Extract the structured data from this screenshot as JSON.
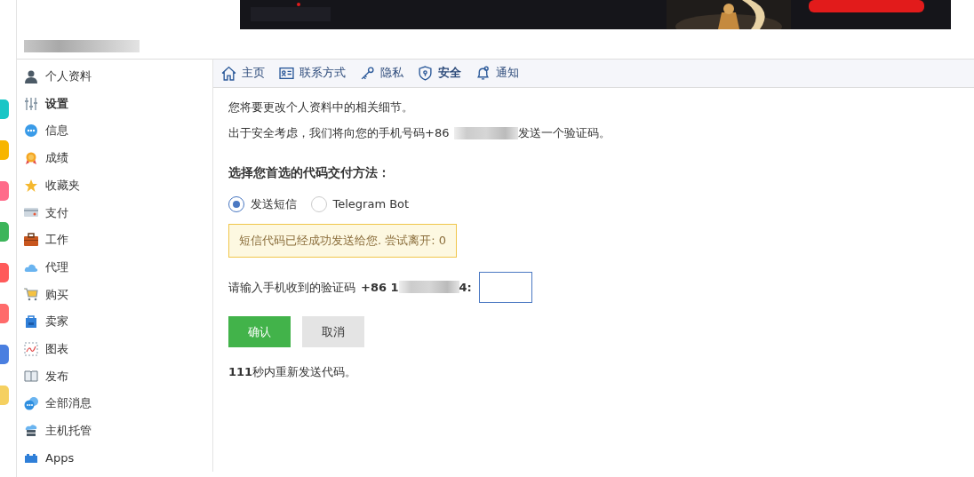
{
  "sidebar": {
    "items": [
      {
        "label": "个人资料",
        "selected": false
      },
      {
        "label": "设置",
        "selected": true
      },
      {
        "label": "信息",
        "selected": false
      },
      {
        "label": "成绩",
        "selected": false
      },
      {
        "label": "收藏夹",
        "selected": false
      },
      {
        "label": "支付",
        "selected": false
      },
      {
        "label": "工作",
        "selected": false
      },
      {
        "label": "代理",
        "selected": false
      },
      {
        "label": "购买",
        "selected": false
      },
      {
        "label": "卖家",
        "selected": false
      },
      {
        "label": "图表",
        "selected": false
      },
      {
        "label": "发布",
        "selected": false
      },
      {
        "label": "全部消息",
        "selected": false
      },
      {
        "label": "主机托管",
        "selected": false
      },
      {
        "label": "Apps",
        "selected": false
      }
    ]
  },
  "tabs": [
    {
      "label": "主页",
      "selected": false
    },
    {
      "label": "联系方式",
      "selected": false
    },
    {
      "label": "隐私",
      "selected": false
    },
    {
      "label": "安全",
      "selected": true
    },
    {
      "label": "通知",
      "selected": false
    }
  ],
  "intro": "您将要更改个人资料中的相关细节。",
  "notice_before": "出于安全考虑，我们将向您的手机号码+86",
  "notice_after": "发送一个验证码。",
  "method_heading": "选择您首选的代码交付方法：",
  "methods": [
    {
      "label": "发送短信",
      "selected": true
    },
    {
      "label": "Telegram Bot",
      "selected": false
    }
  ],
  "alert": "短信代码已经成功发送给您. 尝试离开: 0",
  "code_prompt": "请输入手机收到的验证码",
  "phone_prefix": "+86 1",
  "phone_suffix": "4:",
  "buttons": [
    {
      "label": "确认",
      "kind": "primary"
    },
    {
      "label": "取消",
      "kind": "secondary"
    }
  ],
  "countdown": "**111**秒内重新发送代码。"
}
